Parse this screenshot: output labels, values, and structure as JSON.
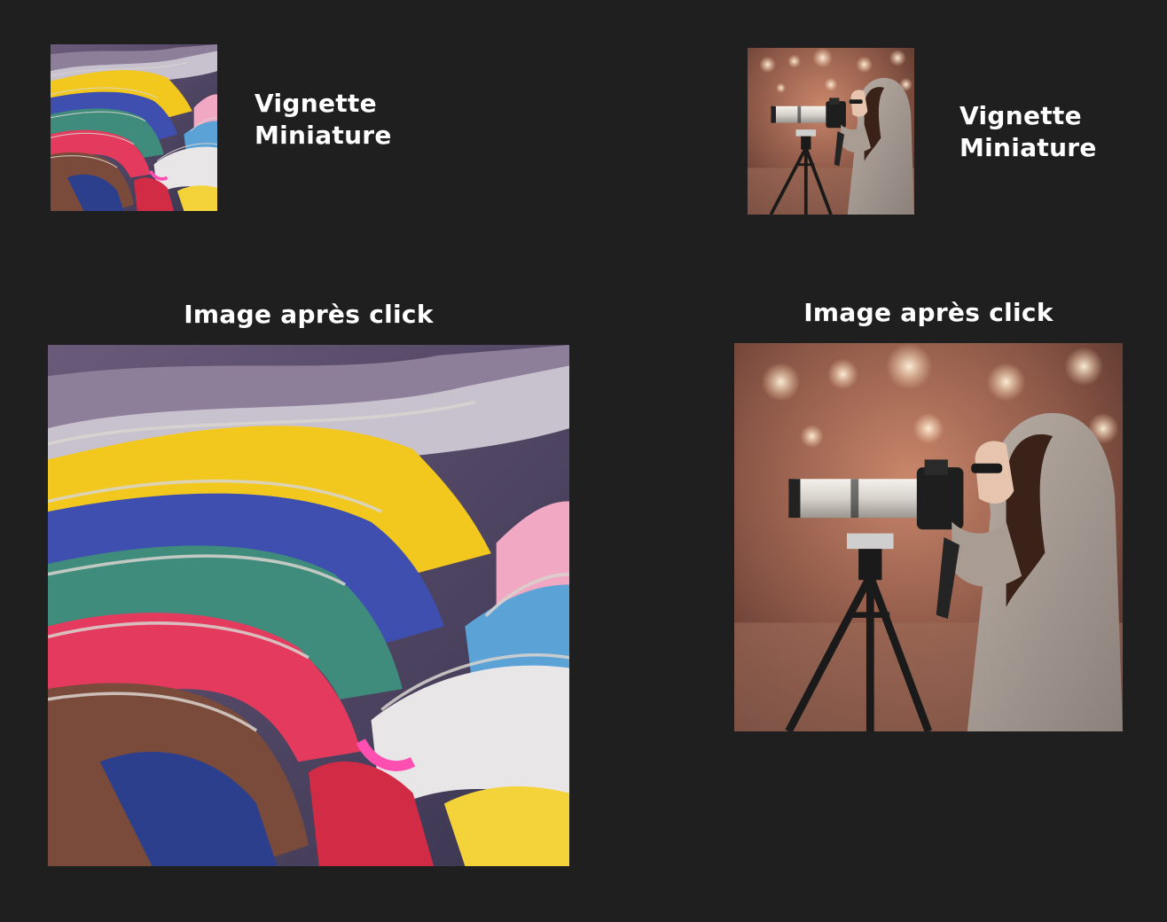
{
  "thumbnails": [
    {
      "caption_line1": "Vignette",
      "caption_line2": "Miniature",
      "image": "magazines-photo"
    },
    {
      "caption_line1": "Vignette",
      "caption_line2": "Miniature",
      "image": "photographer-photo"
    }
  ],
  "enlarged": [
    {
      "heading": "Image après click",
      "image": "magazines-photo"
    },
    {
      "heading": "Image après click",
      "image": "photographer-photo"
    }
  ],
  "colors": {
    "background": "#1f1f1f",
    "text": "#ffffff"
  }
}
